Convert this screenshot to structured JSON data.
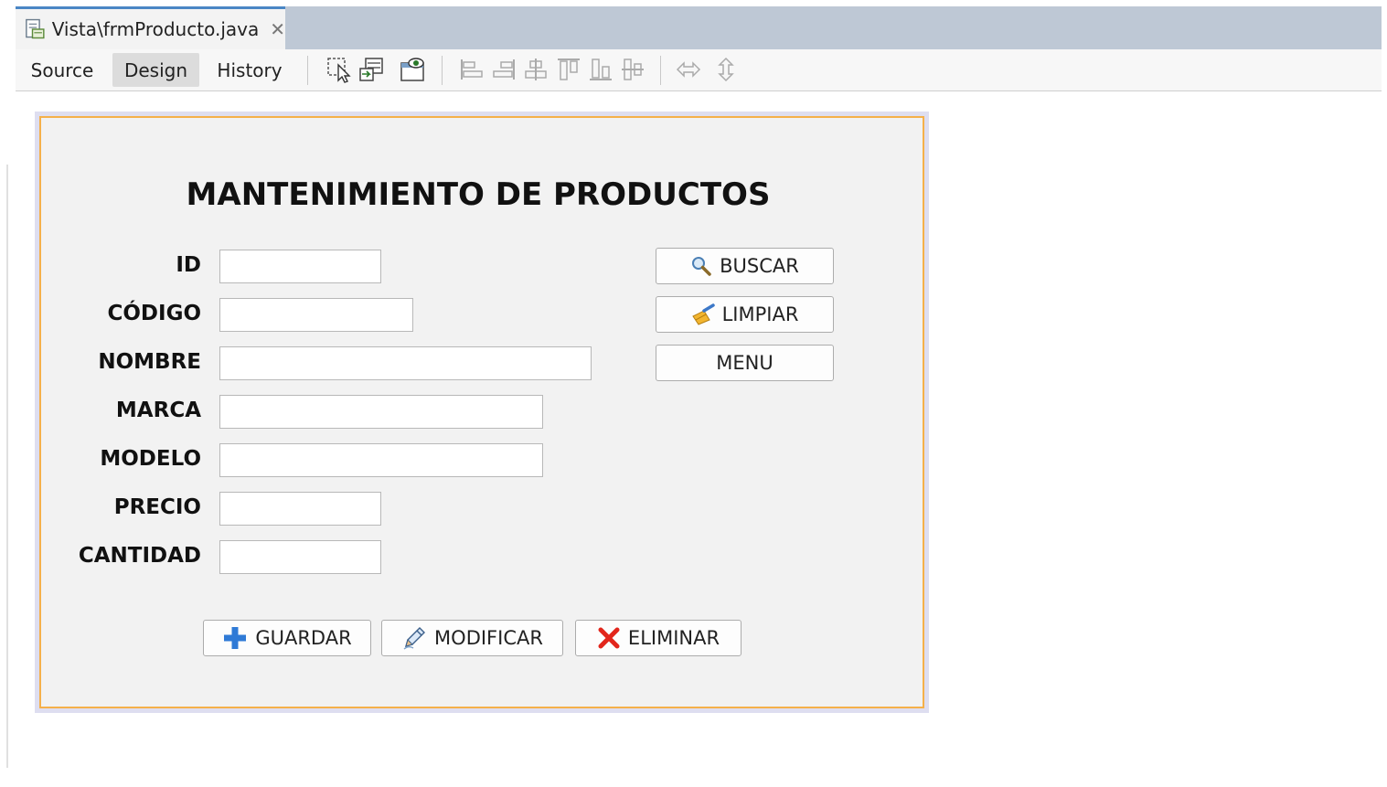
{
  "tab": {
    "title": "Vista\\frmProducto.java",
    "close": "✕"
  },
  "toolbar": {
    "source": "Source",
    "design": "Design",
    "history": "History"
  },
  "form": {
    "title": "MANTENIMIENTO DE PRODUCTOS",
    "labels": {
      "id": "ID",
      "codigo": "CÓDIGO",
      "nombre": "NOMBRE",
      "marca": "MARCA",
      "modelo": "MODELO",
      "precio": "PRECIO",
      "cantidad": "CANTIDAD"
    },
    "values": {
      "id": "",
      "codigo": "",
      "nombre": "",
      "marca": "",
      "modelo": "",
      "precio": "",
      "cantidad": ""
    },
    "buttons": {
      "buscar": "BUSCAR",
      "limpiar": "LIMPIAR",
      "menu": "MENU",
      "guardar": "GUARDAR",
      "modificar": "MODIFICAR",
      "eliminar": "ELIMINAR"
    }
  },
  "colors": {
    "accent_tab": "#4a86c5",
    "form_border": "#f5b04a",
    "plus": "#2f7ad6",
    "delete": "#e2261c"
  }
}
